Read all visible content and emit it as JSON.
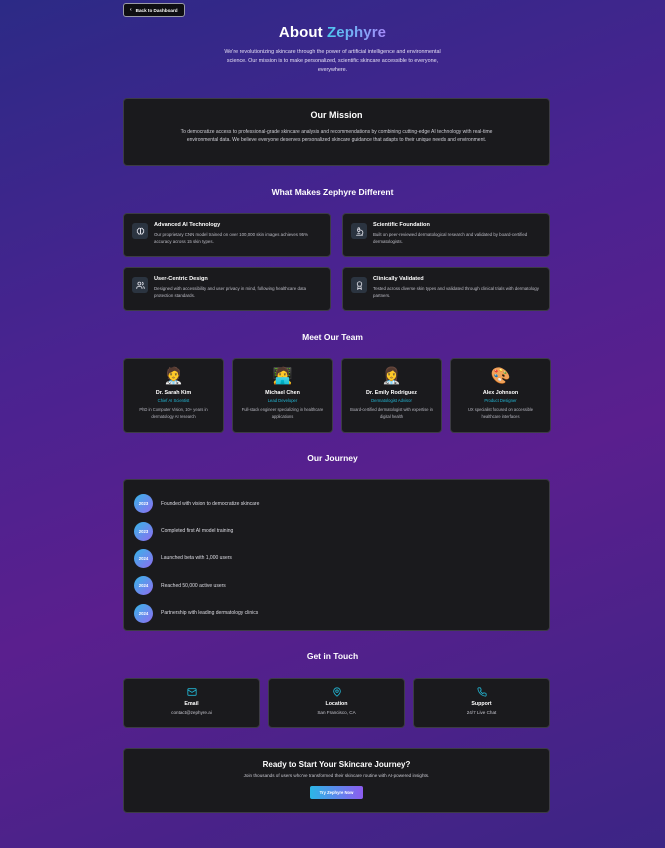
{
  "nav": {
    "back_label": "Back to Dashboard"
  },
  "hero": {
    "title_prefix": "About ",
    "title_brand": "Zephyre",
    "description": "We're revolutionizing skincare through the power of artificial intelligence and environmental science. Our mission is to make personalized, scientific skincare accessible to everyone, everywhere."
  },
  "mission": {
    "title": "Our Mission",
    "text": "To democratize access to professional-grade skincare analysis and recommendations by combining cutting-edge AI technology with real-time environmental data. We believe everyone deserves personalized skincare guidance that adapts to their unique needs and environment."
  },
  "features": {
    "title": "What Makes Zephyre Different",
    "items": [
      {
        "icon": "brain-icon",
        "title": "Advanced AI Technology",
        "text": "Our proprietary CNN model trained on over 100,000 skin images achieves 95% accuracy across 15 skin types."
      },
      {
        "icon": "microscope-icon",
        "title": "Scientific Foundation",
        "text": "Built on peer-reviewed dermatological research and validated by board-certified dermatologists."
      },
      {
        "icon": "users-icon",
        "title": "User-Centric Design",
        "text": "Designed with accessibility and user privacy in mind, following healthcare data protection standards."
      },
      {
        "icon": "award-icon",
        "title": "Clinically Validated",
        "text": "Tested across diverse skin types and validated through clinical trials with dermatology partners."
      }
    ]
  },
  "team": {
    "title": "Meet Our Team",
    "members": [
      {
        "emoji": "🧑‍⚕️",
        "name": "Dr. Sarah Kim",
        "role": "Chief AI Scientist",
        "bio": "PhD in Computer Vision, 10+ years in dermatology AI research"
      },
      {
        "emoji": "🧑‍💻",
        "name": "Michael Chen",
        "role": "Lead Developer",
        "bio": "Full-stack engineer specializing in healthcare applications"
      },
      {
        "emoji": "👩‍⚕️",
        "name": "Dr. Emily Rodriguez",
        "role": "Dermatologist Advisor",
        "bio": "Board-certified dermatologist with expertise in digital health"
      },
      {
        "emoji": "🎨",
        "name": "Alex Johnson",
        "role": "Product Designer",
        "bio": "UX specialist focused on accessible healthcare interfaces"
      }
    ]
  },
  "journey": {
    "title": "Our Journey",
    "milestones": [
      {
        "year": "2023",
        "text": "Founded with vision to democratize skincare"
      },
      {
        "year": "2023",
        "text": "Completed first AI model training"
      },
      {
        "year": "2024",
        "text": "Launched beta with 1,000 users"
      },
      {
        "year": "2024",
        "text": "Reached 50,000 active users"
      },
      {
        "year": "2024",
        "text": "Partnership with leading dermatology clinics"
      }
    ]
  },
  "contact": {
    "title": "Get in Touch",
    "items": [
      {
        "icon": "mail-icon",
        "title": "Email",
        "value": "contact@zephyre.ai"
      },
      {
        "icon": "map-pin-icon",
        "title": "Location",
        "value": "San Francisco, CA"
      },
      {
        "icon": "phone-icon",
        "title": "Support",
        "value": "24/7 Live Chat"
      }
    ]
  },
  "cta": {
    "title": "Ready to Start Your Skincare Journey?",
    "text": "Join thousands of users who've transformed their skincare routine with AI-powered insights.",
    "button_label": "Try Zephyre Now"
  },
  "colors": {
    "accent_cyan": "#22b8d6",
    "accent_purple": "#8d5cf0",
    "card_bg": "#1a1a1d"
  }
}
